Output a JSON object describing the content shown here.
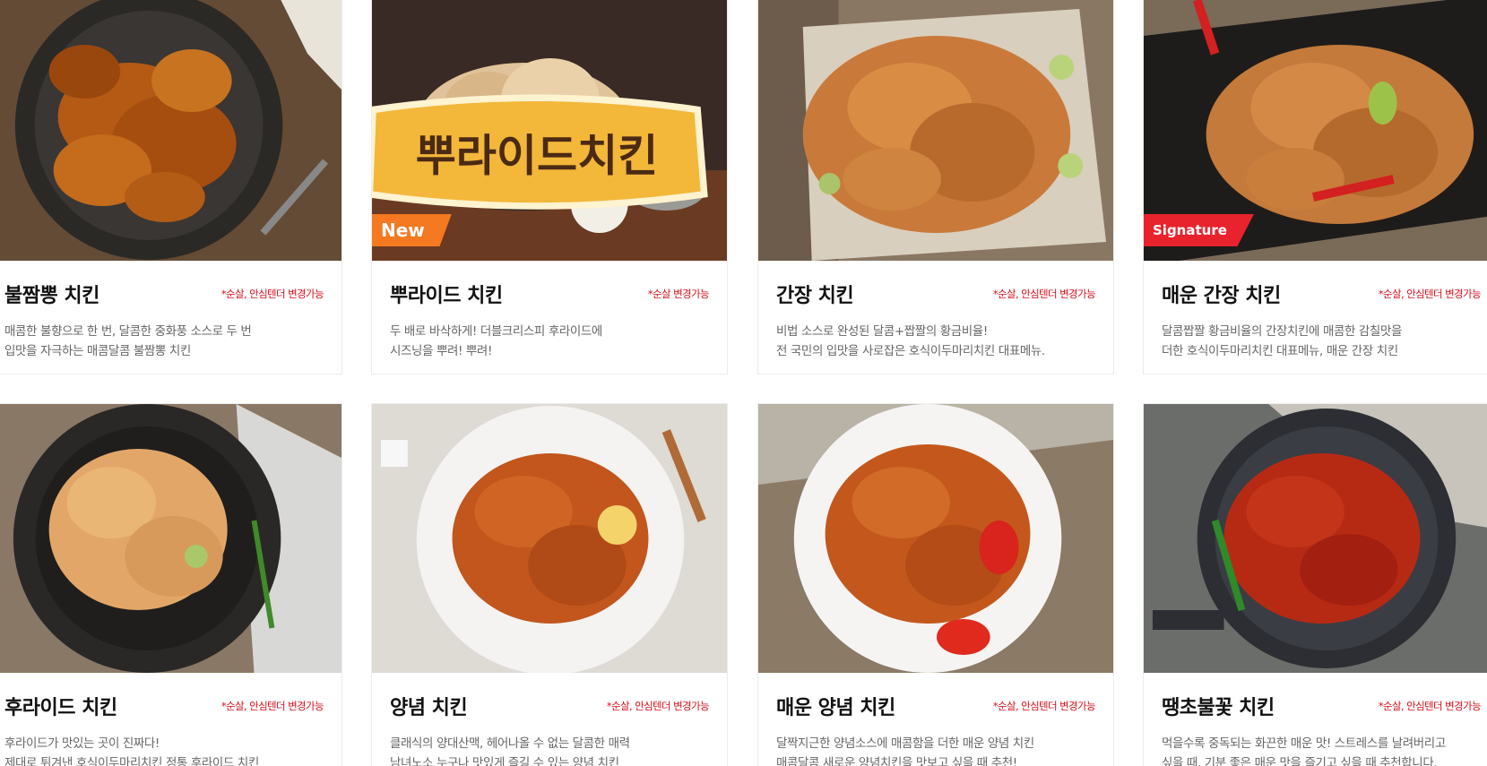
{
  "menu_items": [
    {
      "name": "불짬뽕 치킨",
      "option": "*순살, 안심텐더 변경가능",
      "desc": [
        "매콤한 불향으로 한 번, 달콤한 중화풍 소스로 두 번",
        "입맛을 자극하는 매콤달콤 불짬뽕 치킨"
      ],
      "badge": ""
    },
    {
      "name": "뿌라이드 치킨",
      "option": "*순살 변경가능",
      "desc": [
        "두 배로 바삭하게! 더블크리스피 후라이드에",
        "시즈닝을 뿌려! 뿌려!"
      ],
      "badge": "New",
      "photo_text": "뿌라이드치킨"
    },
    {
      "name": "간장 치킨",
      "option": "*순살, 안심텐더 변경가능",
      "desc": [
        "비법 소스로 완성된 달콤+짭짤의 황금비율!",
        "전 국민의 입맛을 사로잡은 호식이두마리치킨 대표메뉴."
      ],
      "badge": ""
    },
    {
      "name": "매운 간장 치킨",
      "option": "*순살, 안심텐더 변경가능",
      "desc": [
        "달콤짭짤 황금비율의 간장치킨에 매콤한 감칠맛을",
        "더한 호식이두마리치킨 대표메뉴, 매운 간장 치킨"
      ],
      "badge": "Signature"
    },
    {
      "name": "후라이드 치킨",
      "option": "*순살, 안심텐더 변경가능",
      "desc": [
        "후라이드가 맛있는 곳이 진짜다!",
        "제대로 튀겨낸 호식이두마리치킨 정통 후라이드 치킨"
      ],
      "badge": ""
    },
    {
      "name": "양념 치킨",
      "option": "*순살, 안심텐더 변경가능",
      "desc": [
        "클래식의 양대산맥, 헤어나올 수 없는 달콤한 매력",
        "남녀노소 누구나 맛있게 즐길 수 있는 양념 치킨"
      ],
      "badge": ""
    },
    {
      "name": "매운 양념 치킨",
      "option": "*순살, 안심텐더 변경가능",
      "desc": [
        "달짝지근한 양념소스에 매콤함을 더한 매운 양념 치킨",
        "매콤달콤 새로운 양념치킨을 맛보고 싶을 때 추천!"
      ],
      "badge": ""
    },
    {
      "name": "땡초불꽃 치킨",
      "option": "*순살, 안심텐더 변경가능",
      "desc": [
        "먹을수록 중독되는 화끈한 매운 맛! 스트레스를 날려버리고",
        "싶을 때, 기분 좋은 매운 맛을 즐기고 싶을 때 추천합니다."
      ],
      "badge": ""
    }
  ],
  "colors": {
    "option_red": "#d60f1c",
    "badge_new": "#f47920",
    "badge_signature": "#e8232d"
  }
}
